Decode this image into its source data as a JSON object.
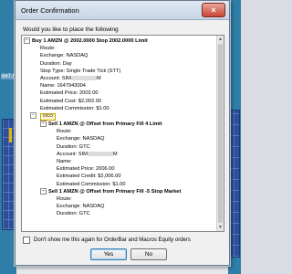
{
  "background": {
    "left_number": "847.56"
  },
  "dialog": {
    "title": "Order Confirmation",
    "close_label": "×",
    "prompt": "Would you like to place the following",
    "tree": {
      "main_order": {
        "toggle": "−",
        "label": "Buy 1 AMZN @ 2002.0000 Stop 2002.0000 Limit",
        "fields": [
          "Route:",
          "Exchange: NASDAQ",
          "Duration: Day",
          "Stop Type: Single Trade Tick (STT)",
          "Name: 1647943004",
          "Estimated Price: 2002.00",
          "Estimated Cost: $2,002.00",
          "Estimated Commission: $1.00"
        ],
        "account_label": "Account: SIM",
        "account_suffix": "M"
      },
      "oco": {
        "toggle": "−",
        "badge": "OCO"
      },
      "sub_order_1": {
        "toggle": "−",
        "label": "Sell 1 AMZN @ Offset from Primary Fill 4 Limit",
        "fields": [
          "Route:",
          "Exchange: NASDAQ",
          "Duration: GTC",
          "Name:",
          "Estimated Price: 2006.00",
          "Estimated Credit: $2,006.00",
          "Estimated Commission: $1.00"
        ],
        "account_label": "Account: SIM",
        "account_suffix": "M"
      },
      "sub_order_2": {
        "toggle": "−",
        "label": "Sell 1 AMZN @ Offset from Primary Fill -5 Stop Market",
        "fields": [
          "Route:",
          "Exchange: NASDAQ",
          "Duration: GTC"
        ]
      }
    },
    "checkbox_label": "Don't show me this again for OrderBar and Macros Equity orders",
    "yes_label": "Yes",
    "no_label": "No"
  }
}
